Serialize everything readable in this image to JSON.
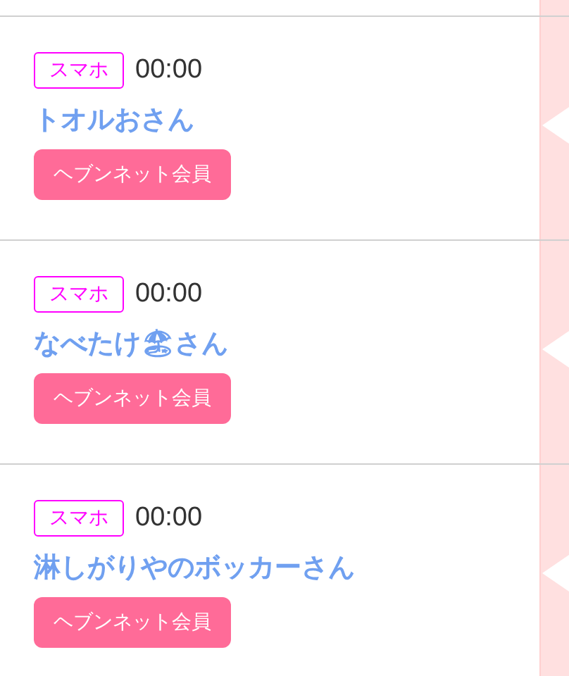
{
  "messages": [
    {
      "device": "スマホ",
      "time": "00:00",
      "name": "トオルおさん",
      "member": "ヘブンネット会員"
    },
    {
      "device": "スマホ",
      "time": "00:00",
      "name": "なべたけ🏖さん",
      "member": "ヘブンネット会員"
    },
    {
      "device": "スマホ",
      "time": "00:00",
      "name": "淋しがりやのボッカーさん",
      "member": "ヘブンネット会員"
    }
  ]
}
